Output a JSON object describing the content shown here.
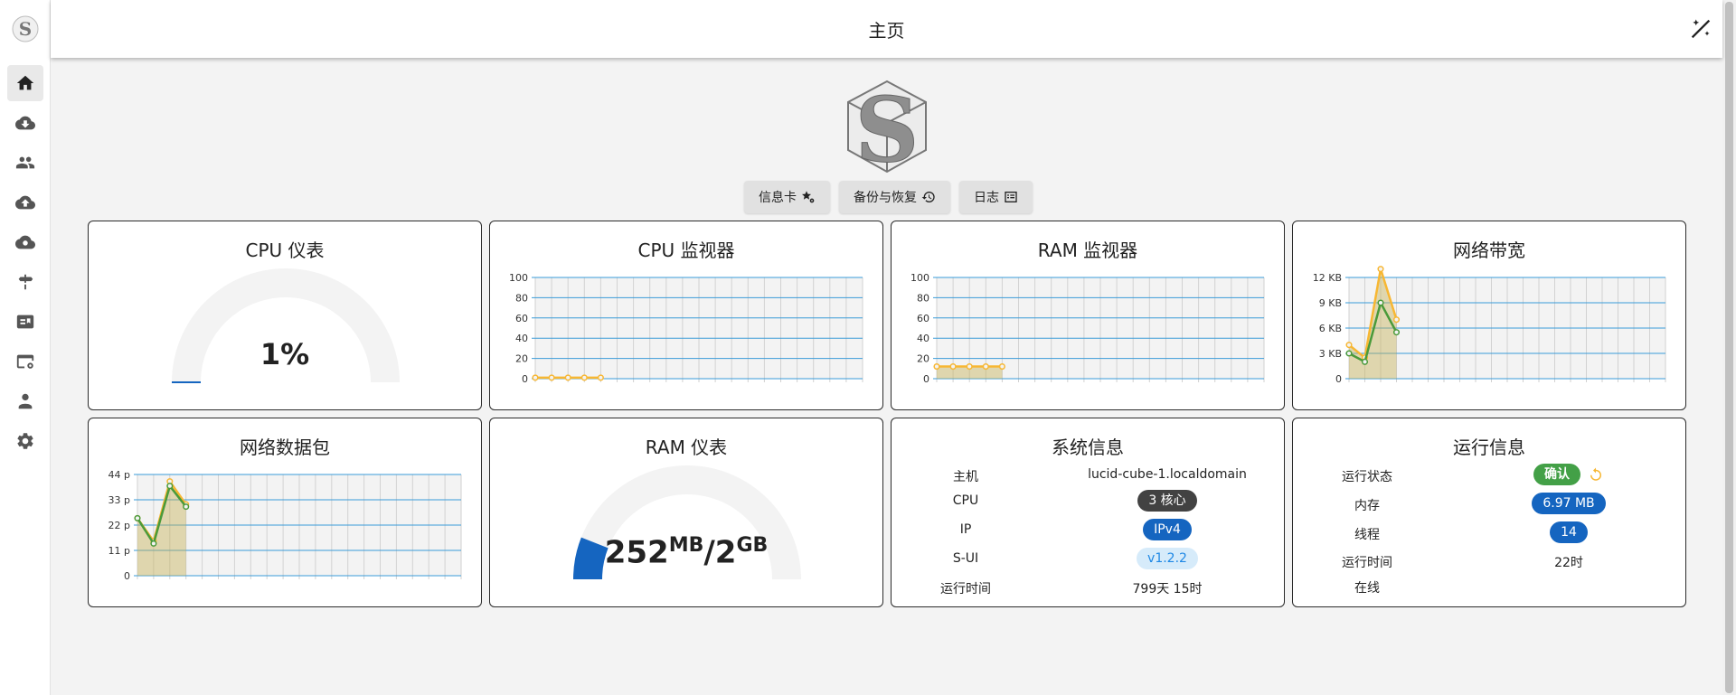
{
  "app": {
    "header_title": "主页"
  },
  "sidebar": {
    "items": [
      {
        "icon": "home-icon",
        "active": true
      },
      {
        "icon": "cloud-download-icon",
        "active": false
      },
      {
        "icon": "users-icon",
        "active": false
      },
      {
        "icon": "cloud-upload-icon",
        "active": false
      },
      {
        "icon": "cloud-route-icon",
        "active": false
      },
      {
        "icon": "signpost-icon",
        "active": false
      },
      {
        "icon": "card-tag-icon",
        "active": false
      },
      {
        "icon": "web-settings-icon",
        "active": false
      },
      {
        "icon": "admin-icon",
        "active": false
      },
      {
        "icon": "gear-icon",
        "active": false
      }
    ]
  },
  "actions": {
    "tiles_label": "信息卡",
    "backup_label": "备份与恢复",
    "logs_label": "日志"
  },
  "cards": {
    "cpu_gauge": {
      "title": "CPU 仪表",
      "value_text": "1%",
      "fraction": 0.01
    },
    "cpu_monitor": {
      "title": "CPU 监视器"
    },
    "ram_monitor": {
      "title": "RAM 监视器"
    },
    "net_bandwidth": {
      "title": "网络带宽"
    },
    "net_packets": {
      "title": "网络数据包"
    },
    "ram_gauge": {
      "title": "RAM 仪表",
      "used": "252",
      "used_unit": "MB",
      "sep": "/",
      "total": "2",
      "total_unit": "GB",
      "fraction": 0.12
    },
    "system_info": {
      "title": "系统信息",
      "host_label": "主机",
      "host_value": "lucid-cube-1.localdomain",
      "cpu_label": "CPU",
      "cpu_value": "3 核心",
      "ip_label": "IP",
      "ip_value": "IPv4",
      "sui_label": "S-UI",
      "sui_value": "v1.2.2",
      "uptime_label": "运行时间",
      "uptime_value": "799天 15时"
    },
    "run_info": {
      "title": "运行信息",
      "status_label": "运行状态",
      "status_value": "确认",
      "memory_label": "内存",
      "memory_value": "6.97 MB",
      "threads_label": "线程",
      "threads_value": "14",
      "uptime_label": "运行时间",
      "uptime_value": "22时",
      "online_label": "在线"
    }
  },
  "colors": {
    "accent_orange": "#f7b733",
    "green": "#4a9a3a",
    "blue": "#1565c0",
    "grid_blue": "#3a9bd8",
    "success_green": "#43a047",
    "dark_chip": "#424242",
    "light_blue_chip": "#d6ebfa"
  },
  "chart_data": [
    {
      "type": "line",
      "name_ref": "cpu_monitor",
      "yticks": [
        "0",
        "20",
        "40",
        "60",
        "80",
        "100"
      ],
      "ylim": [
        0,
        100
      ],
      "x_slots": 20,
      "series": [
        {
          "values": [
            1,
            1,
            1,
            1,
            1
          ]
        }
      ]
    },
    {
      "type": "area",
      "name_ref": "ram_monitor",
      "yticks": [
        "0",
        "20",
        "40",
        "60",
        "80",
        "100"
      ],
      "ylim": [
        0,
        100
      ],
      "x_slots": 20,
      "series": [
        {
          "values": [
            12,
            12,
            12,
            12,
            12
          ]
        }
      ]
    },
    {
      "type": "area",
      "name_ref": "net_bandwidth",
      "yticks": [
        "0",
        "3 KB",
        "6 KB",
        "9 KB",
        "12 KB"
      ],
      "ylim": [
        0,
        12
      ],
      "unit": "KB",
      "x_slots": 20,
      "series": [
        {
          "values": [
            4,
            2.5,
            13,
            7
          ]
        },
        {
          "values": [
            3,
            2,
            9,
            5.5
          ]
        }
      ]
    },
    {
      "type": "area",
      "name_ref": "net_packets",
      "yticks": [
        "0",
        "11 p",
        "22 p",
        "33 p",
        "44 p"
      ],
      "ylim": [
        0,
        44
      ],
      "unit": "p",
      "x_slots": 20,
      "series": [
        {
          "values": [
            25,
            15,
            41,
            31
          ]
        },
        {
          "values": [
            25,
            14,
            39,
            30
          ]
        }
      ]
    }
  ]
}
